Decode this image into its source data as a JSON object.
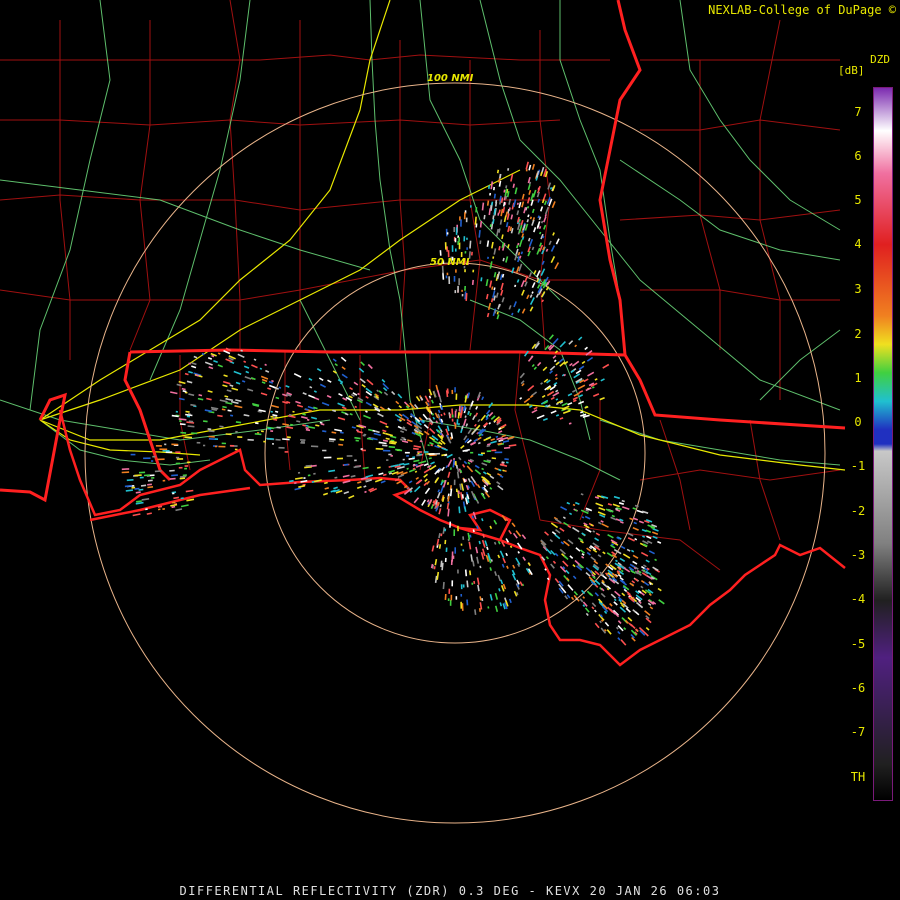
{
  "credit": "NEXLAB-College of DuPage ©",
  "product_code": "DZD",
  "units": "[dB]",
  "footer": "DIFFERENTIAL REFLECTIVITY (ZDR) 0.3 DEG - KEVX 20 JAN 26 06:03",
  "range_rings": [
    {
      "label": "50 NMI",
      "radius_nmi": 50
    },
    {
      "label": "100 NMI",
      "radius_nmi": 100
    }
  ],
  "colorbar": {
    "ticks": [
      "7",
      "6",
      "5",
      "4",
      "3",
      "2",
      "1",
      "0",
      "-1",
      "-2",
      "-3",
      "-4",
      "-5",
      "-6",
      "-7",
      "TH"
    ],
    "colors": {
      "top": "#7c2bb0",
      "white": "#ffffff",
      "pink": "#f070a0",
      "red": "#e02020",
      "orange": "#f08020",
      "yellow": "#f0e020",
      "green": "#40d040",
      "cyan": "#20c0d0",
      "blue": "#2030c0",
      "gray": "#c8c8c8",
      "dark": "#202020",
      "violet": "#502080"
    }
  },
  "map_colors": {
    "state_border": "#ff2020",
    "county_border": "#a01010",
    "highway": "#e8e800",
    "roads": "#6fe07f",
    "ring": "#e9b48a"
  }
}
